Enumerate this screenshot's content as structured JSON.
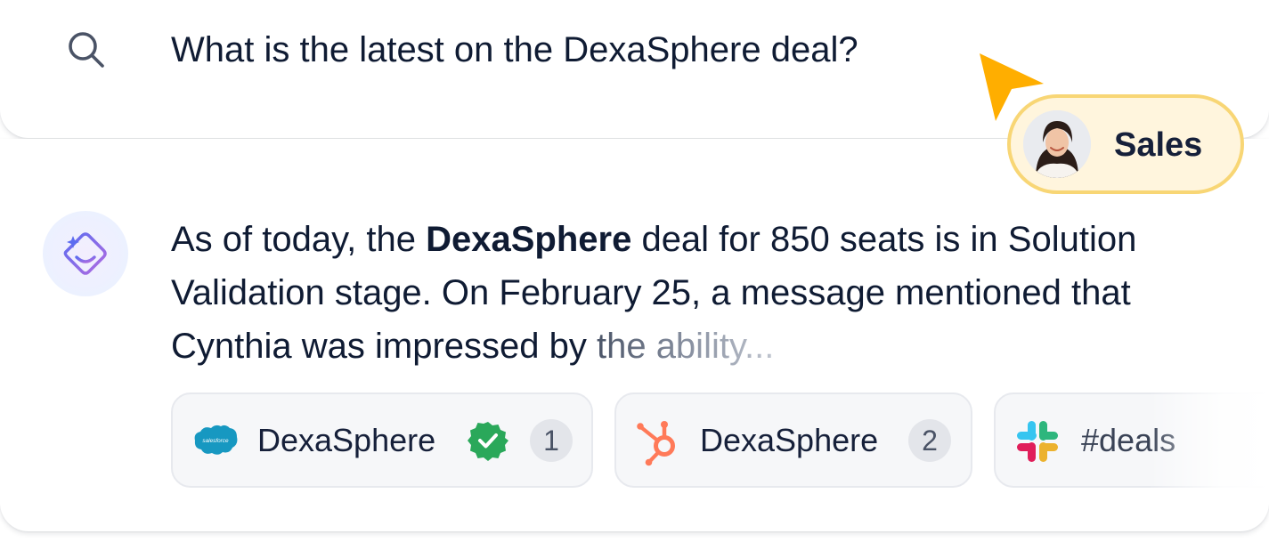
{
  "search": {
    "query": "What is the latest on the DexaSphere deal?",
    "icon": "search-icon"
  },
  "user_tag": {
    "label": "Sales",
    "avatar": "avatar"
  },
  "answer": {
    "intro": "As of today, the ",
    "deal_name": "DexaSphere",
    "body": " deal for 850 seats is in Solution Validation stage. On February 25, a message mentioned that Cynthia was impressed by ",
    "faded_tail": "the ability..."
  },
  "sources": [
    {
      "icon": "salesforce-icon",
      "label": "DexaSphere",
      "verified": true,
      "count": "1"
    },
    {
      "icon": "hubspot-icon",
      "label": "DexaSphere",
      "verified": false,
      "count": "2"
    },
    {
      "icon": "slack-icon",
      "label": "#deals"
    }
  ],
  "colors": {
    "accent_yellow": "#f8d675",
    "cursor_orange": "#ffae00",
    "verified_green": "#2aa85a",
    "hubspot_orange": "#ff7a59",
    "salesforce_blue": "#1798c1"
  }
}
